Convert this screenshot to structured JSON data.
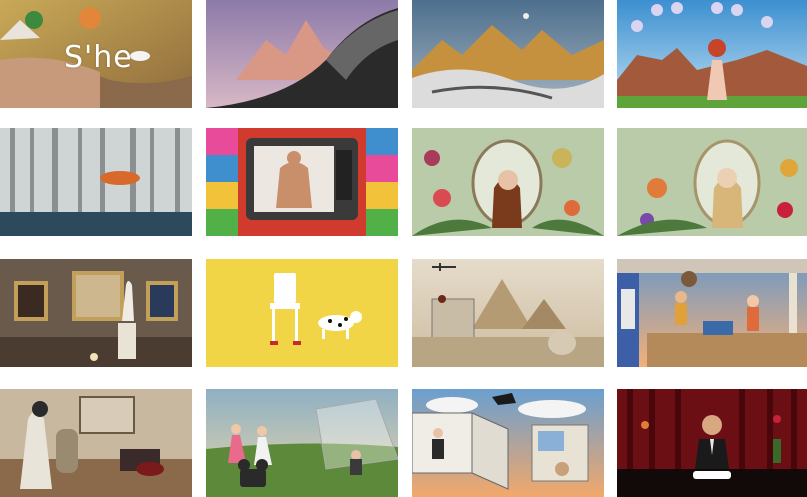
{
  "gallery": {
    "items": [
      {
        "id": "she",
        "overlay_title": "S'he"
      },
      {
        "id": "pink-mountain-body"
      },
      {
        "id": "golden-mountain-body"
      },
      {
        "id": "moon-phases-redhead"
      },
      {
        "id": "foggy-forest"
      },
      {
        "id": "tv-pop-art"
      },
      {
        "id": "floral-arch-redhead"
      },
      {
        "id": "floral-arch-blonde"
      },
      {
        "id": "museum-gallery"
      },
      {
        "id": "yellow-chair-dalmatian"
      },
      {
        "id": "pyramids-biplane"
      },
      {
        "id": "porch-scene"
      },
      {
        "id": "surreal-bedroom"
      },
      {
        "id": "field-projector"
      },
      {
        "id": "sky-box-room"
      },
      {
        "id": "red-curtain-dinner"
      }
    ]
  },
  "colors": {
    "background": "#ffffff",
    "pop_yellow": "#f2d447",
    "stage_red": "#6b0f14"
  }
}
